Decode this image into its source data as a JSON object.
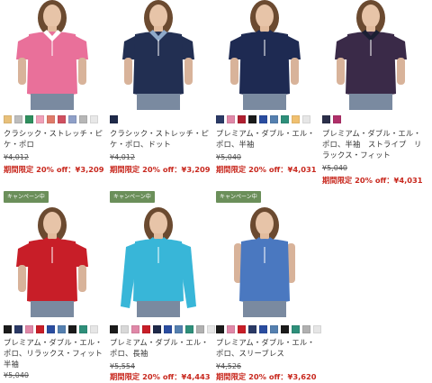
{
  "products": [
    {
      "name": "クラシック・ストレッチ・ピケ・ポロ",
      "original_price": "¥4,012",
      "sale_label": "期間限定 20% off：¥3,209",
      "badge": "",
      "shirt_color": "#e9709a",
      "collar_color": "#ffffff",
      "swatches": [
        "#e8c07a",
        "#bdbdbd",
        "#2f8f5e",
        "#f0a0b8",
        "#e07b6a",
        "#d05060",
        "#8fa0c8",
        "#b7b7b7",
        "#e8e8e8"
      ]
    },
    {
      "name": "クラシック・ストレッチ・ピケ・ポロ、ドット",
      "original_price": "¥4,012",
      "sale_label": "期間限定 20% off：¥3,209",
      "badge": "",
      "shirt_color": "#222f52",
      "collar_color": "#8fa9c9",
      "swatches": [
        "#1f2a4a"
      ]
    },
    {
      "name": "プレミアム・ダブル・エル・ポロ、半袖",
      "original_price": "¥5,040",
      "sale_label": "期間限定 20% off：¥4,031",
      "badge": "",
      "shirt_color": "#1e2a52",
      "collar_color": "#1e2a52",
      "swatches": [
        "#2b3a66",
        "#e088a8",
        "#b02030",
        "#1b1b1b",
        "#2a4da0",
        "#5580b0",
        "#2e8f7a",
        "#f0c070",
        "#e6e6e6"
      ]
    },
    {
      "name": "プレミアム・ダブル・エル・ポロ、半袖　ストライプ　リラックス・フィット",
      "original_price": "¥5,040",
      "sale_label": "期間限定 20% off：¥4,031",
      "badge": "",
      "shirt_color": "#3a2a48",
      "collar_color": "#1b1f33",
      "swatches": [
        "#2b2f4a",
        "#b0306a"
      ]
    },
    {
      "name": "プレミアム・ダブル・エル・ポロ、リラックス・フィット　半袖",
      "original_price": "¥5,040",
      "sale_label": "",
      "badge": "キャンペーン中",
      "shirt_color": "#c81e28",
      "collar_color": "#c81e28",
      "swatches": [
        "#1b1b1b",
        "#2b3a66",
        "#e088a8",
        "#c81e28",
        "#2a4da0",
        "#5580b0",
        "#1b1b1b",
        "#2e8f7a",
        "#e6e6e6"
      ]
    },
    {
      "name": "プレミアム・ダブル・エル・ポロ、長袖",
      "original_price": "¥5,554",
      "sale_label": "期間限定 20% off：¥4,443",
      "badge": "キャンペーン中",
      "shirt_color": "#38b6d8",
      "collar_color": "#38b6d8",
      "swatches": [
        "#1b1b1b",
        "#d8d8d8",
        "#e088a8",
        "#c81e28",
        "#1f2a4a",
        "#2a4da0",
        "#5580b0",
        "#2e8f7a",
        "#b0b0b0",
        "#e6e6e6"
      ]
    },
    {
      "name": "プレミアム・ダブル・エル・ポロ、スリーブレス",
      "original_price": "¥4,526",
      "sale_label": "期間限定 20% off：¥3,620",
      "badge": "キャンペーン中",
      "shirt_color": "#4a78c0",
      "collar_color": "#4a78c0",
      "swatches": [
        "#1b1b1b",
        "#e088a8",
        "#c81e28",
        "#2b3a66",
        "#2a4da0",
        "#5580b0",
        "#1b1b1b",
        "#2e8f7a",
        "#b0b0b0",
        "#e6e6e6"
      ]
    }
  ]
}
